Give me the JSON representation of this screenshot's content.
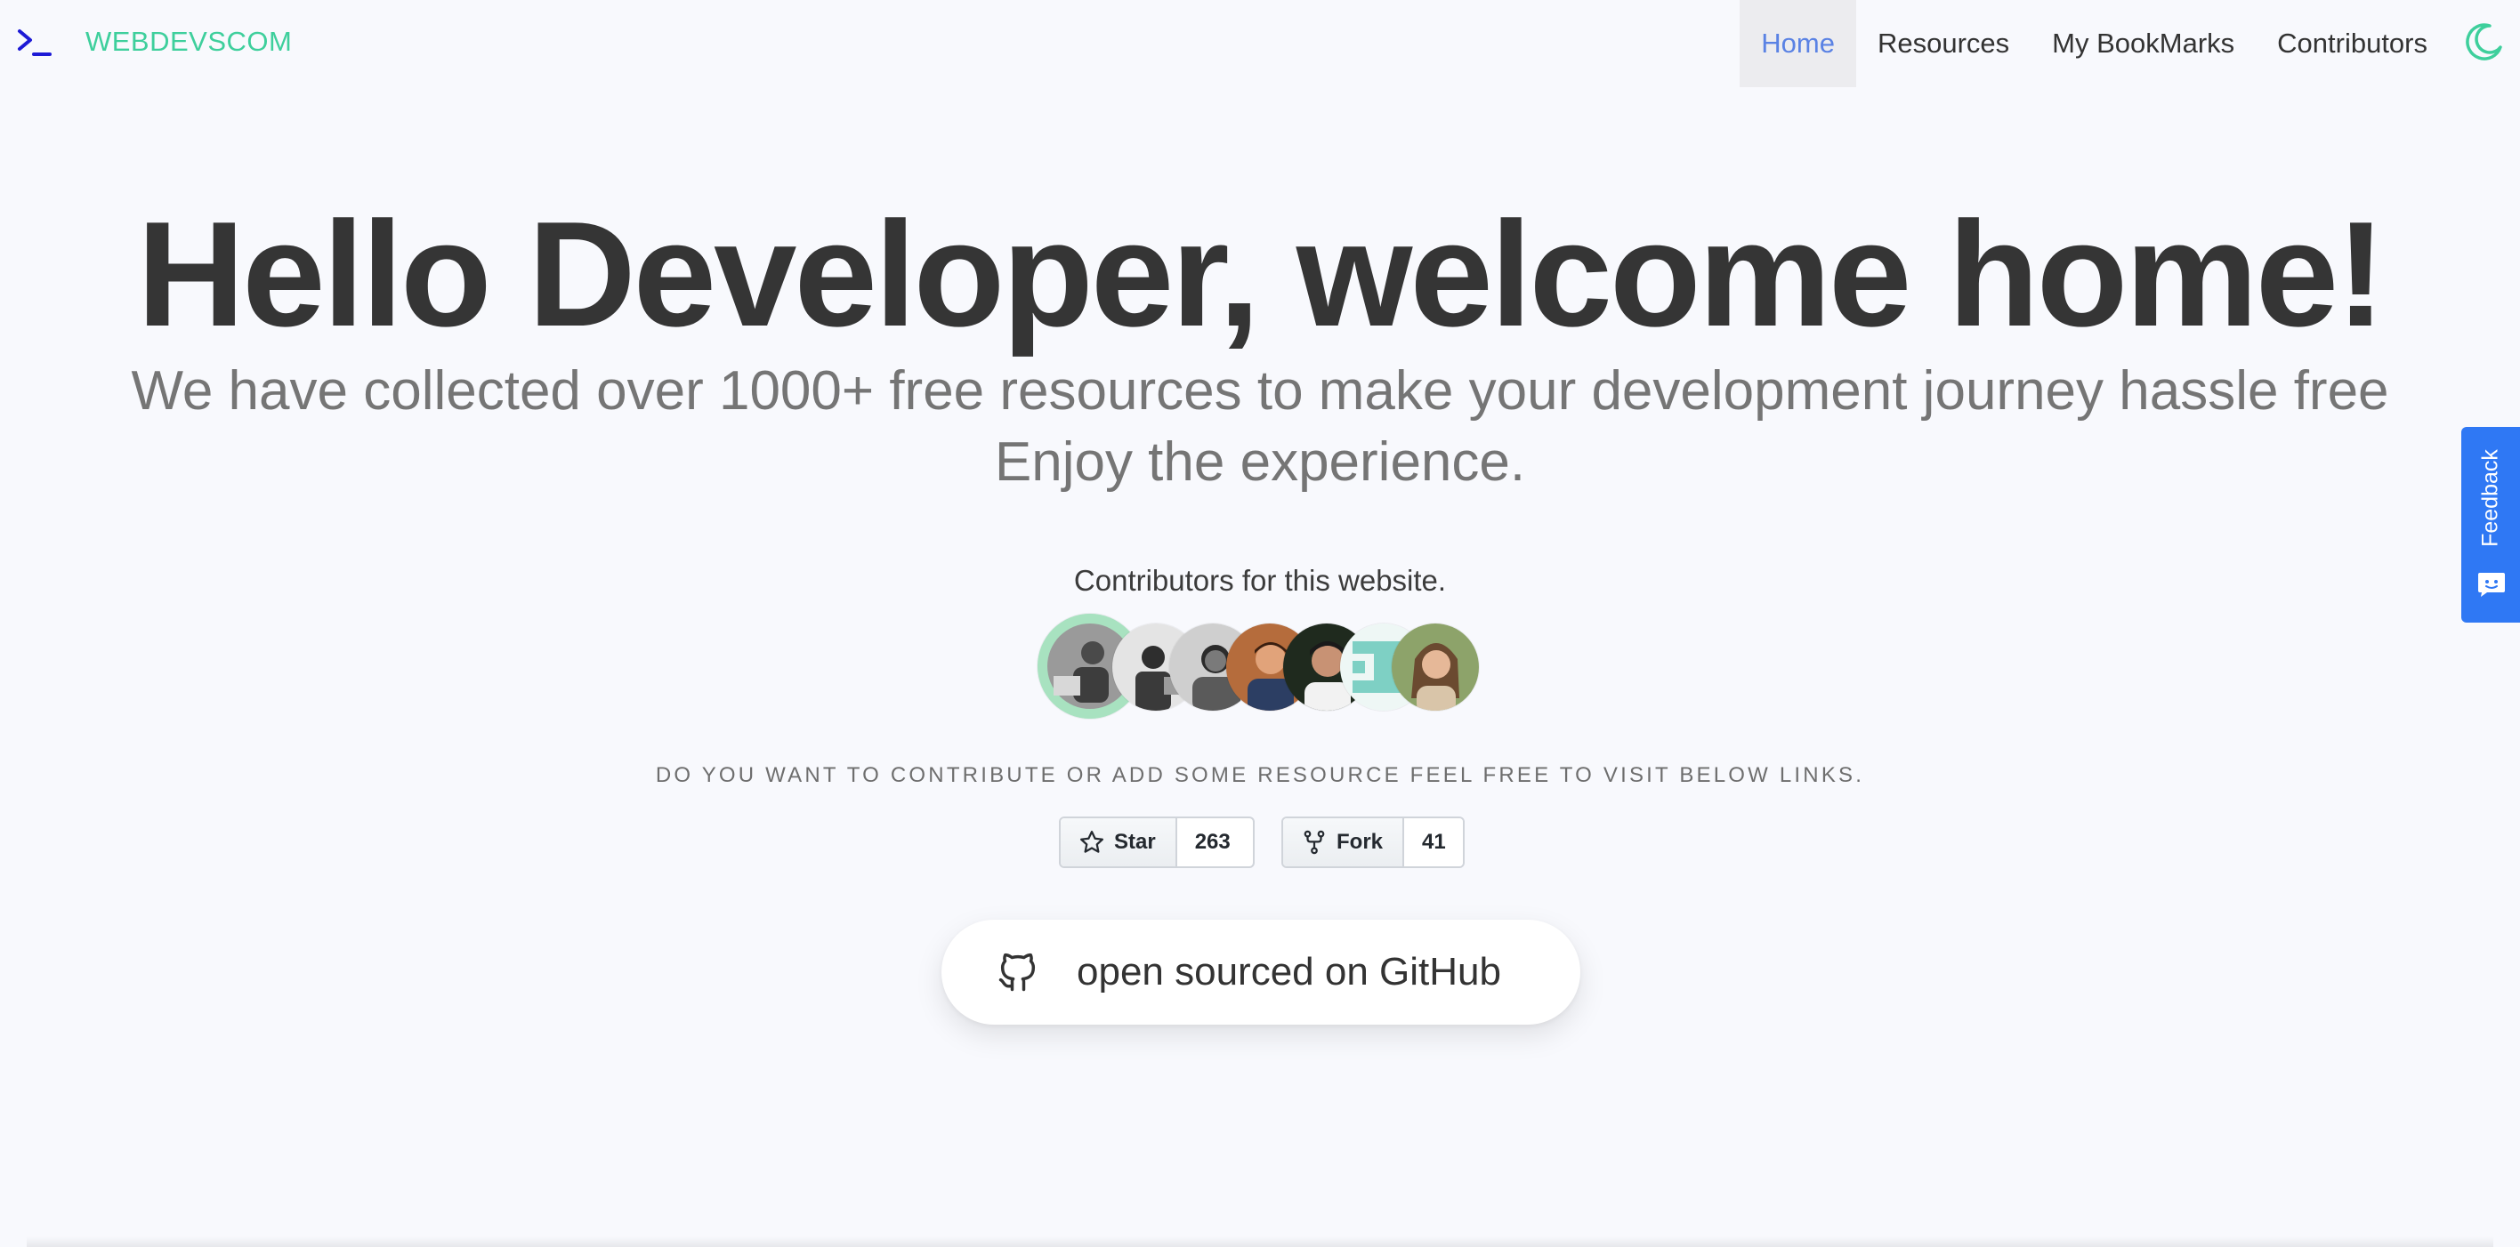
{
  "brand": {
    "icon": "terminal-prompt-icon",
    "name": "WEBDEVSCOM",
    "color": "#3ecf9c"
  },
  "nav": {
    "items": [
      {
        "label": "Home",
        "active": true
      },
      {
        "label": "Resources",
        "active": false
      },
      {
        "label": "My BookMarks",
        "active": false
      },
      {
        "label": "Contributors",
        "active": false
      }
    ],
    "theme_toggle_icon": "moon-icon",
    "active_color": "#5a82e4"
  },
  "hero": {
    "title": "Hello Developer, welcome home!",
    "subtitle_line1": "We have collected over 1000+ free resources to make your development journey hassle free",
    "subtitle_line2": "Enjoy the experience."
  },
  "contributors": {
    "label": "Contributors for this website.",
    "avatar_count": 7
  },
  "cta": {
    "text": "DO YOU WANT TO CONTRIBUTE OR ADD SOME RESOURCE FEEL FREE TO VISIT BELOW LINKS."
  },
  "github_buttons": {
    "star": {
      "label": "Star",
      "count": "263",
      "icon": "star-icon"
    },
    "fork": {
      "label": "Fork",
      "count": "41",
      "icon": "fork-icon"
    }
  },
  "github_link": {
    "label": "open sourced on GitHub",
    "icon": "github-icon"
  },
  "feedback": {
    "label": "Feedback",
    "icon": "chat-icon",
    "color": "#2f78f4"
  }
}
